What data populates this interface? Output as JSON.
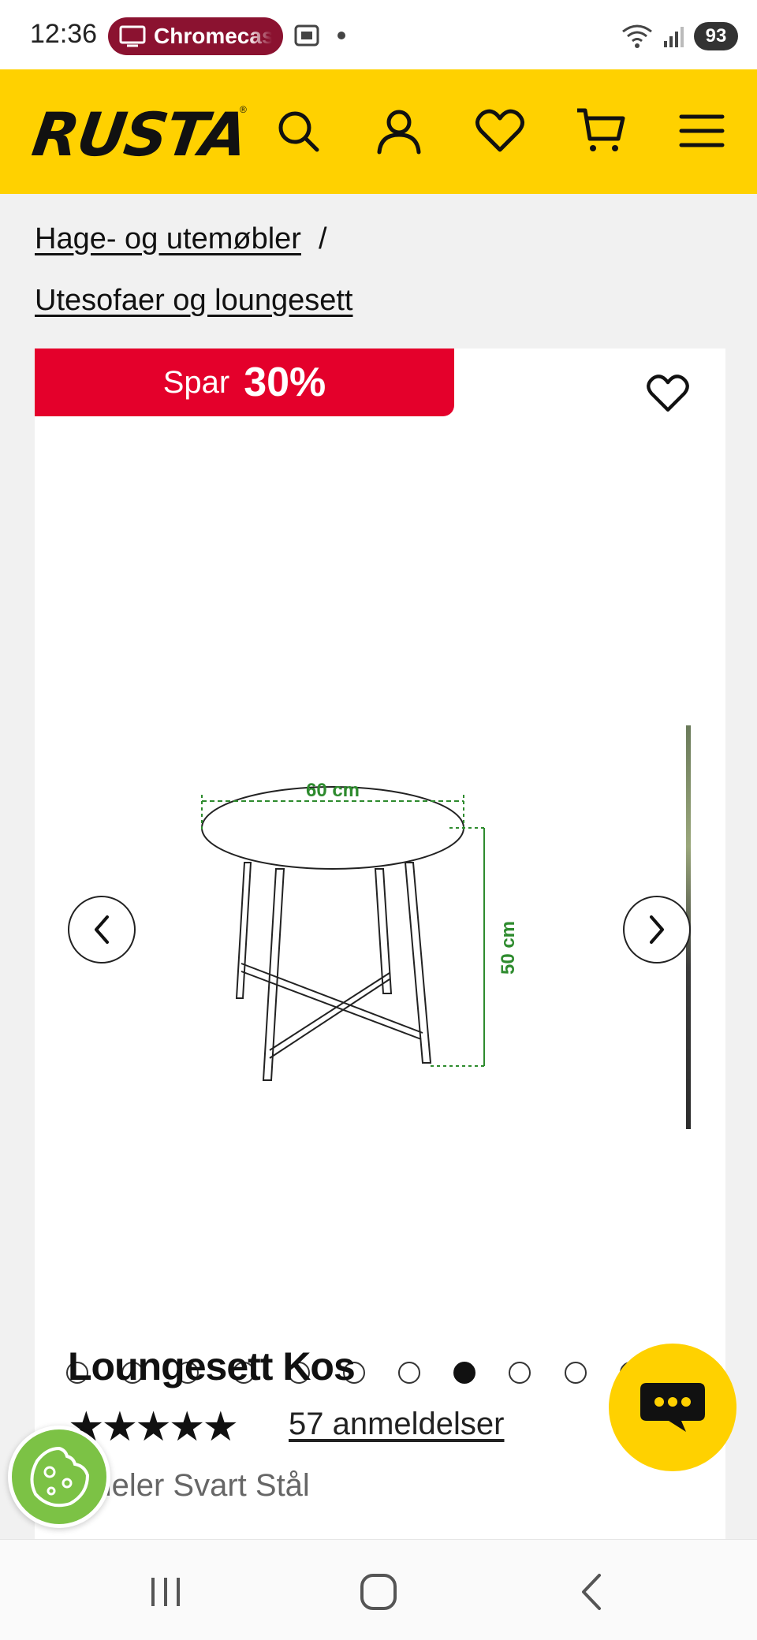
{
  "status_bar": {
    "time": "12:36",
    "cast_label": "Chromecast",
    "battery": "93"
  },
  "header": {
    "logo": "RUSTA",
    "icons": [
      "search-icon",
      "account-icon",
      "wishlist-icon",
      "cart-icon",
      "menu-icon"
    ],
    "background": "#ffd100"
  },
  "breadcrumb": {
    "items": [
      "Hage- og utemøbler",
      "Utesofaer og loungesett"
    ],
    "separator": "/"
  },
  "product": {
    "badge_label": "Spar",
    "badge_value": "30%",
    "badge_color": "#e4002b",
    "image": {
      "width_label": "60 cm",
      "height_label": "50 cm",
      "annotation_color": "#2e8b2e"
    },
    "carousel": {
      "slide_count": 12,
      "active_index": 7
    },
    "title": "Loungesett Kos",
    "rating": 5,
    "stars": "★★★★★",
    "reviews": "57 anmeldelser",
    "variant": "4 deler Svart Stål"
  }
}
